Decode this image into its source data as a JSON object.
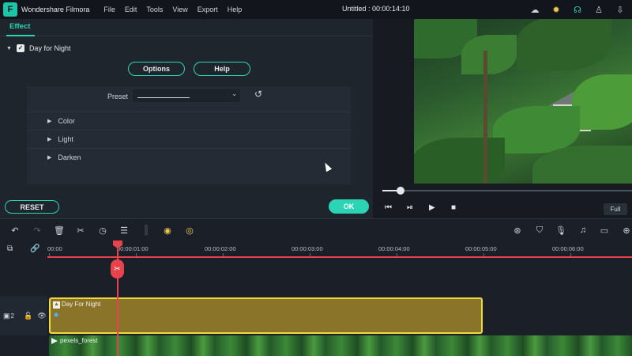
{
  "app": {
    "name": "Wondershare Filmora",
    "title": "Untitled : 00:00:14:10",
    "menu": [
      "File",
      "Edit",
      "Tools",
      "View",
      "Export",
      "Help"
    ]
  },
  "top_icons": [
    "cloud-icon",
    "bulb-icon",
    "headset-icon",
    "user-icon",
    "download-icon"
  ],
  "effect_panel": {
    "tab": "Effect",
    "effect_name": "Day for Night",
    "enabled": true,
    "options_label": "Options",
    "help_label": "Help",
    "preset_label": "Preset",
    "preset_value": "",
    "sections": [
      "Color",
      "Light",
      "Darken"
    ],
    "reset_label": "RESET",
    "ok_label": "OK"
  },
  "preview": {
    "progress": 0.1,
    "full_label": "Full"
  },
  "timeline": {
    "ticks": [
      "00:00",
      "00:00:01:00",
      "00:00:02:00",
      "00:00:03:00",
      "00:00:04:00",
      "00:00:05:00",
      "00:00:06:00"
    ],
    "track_number": "2",
    "effect_clip": "Day For Night",
    "video_clip": "pexels_forest"
  },
  "colors": {
    "accent": "#2cd4b6",
    "playhead": "#e8434d",
    "effect_clip": "#8a7429",
    "effect_border": "#f0d93a"
  }
}
